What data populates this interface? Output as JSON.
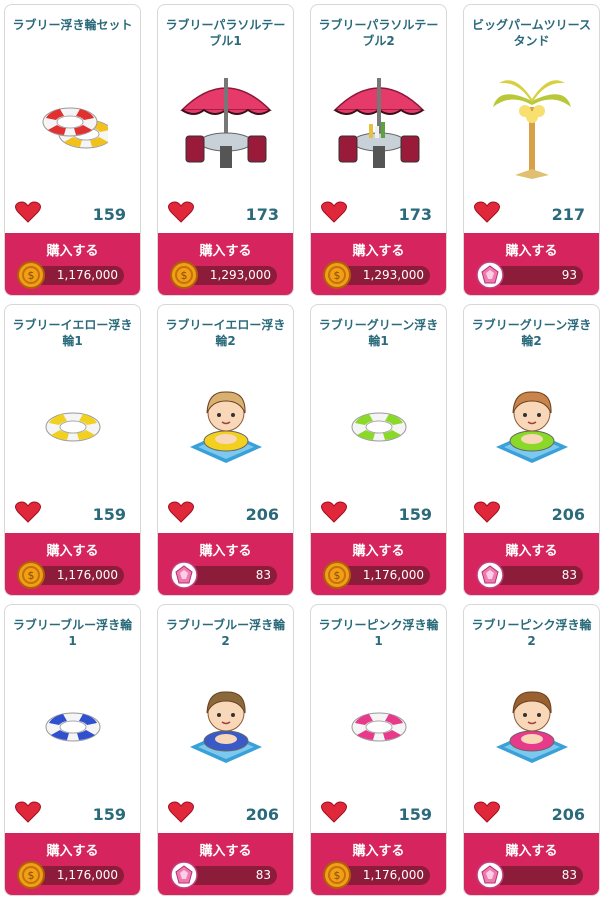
{
  "buy_label": "購入する",
  "items": [
    {
      "name": "ラブリー浮き輪セット",
      "likes": "159",
      "currency": "coin",
      "price": "1,176,000",
      "art": "ringset"
    },
    {
      "name": "ラブリーパラソルテーブル1",
      "likes": "173",
      "currency": "coin",
      "price": "1,293,000",
      "art": "parasol1"
    },
    {
      "name": "ラブリーパラソルテーブル2",
      "likes": "173",
      "currency": "coin",
      "price": "1,293,000",
      "art": "parasol2"
    },
    {
      "name": "ビッグパームツリースタンド",
      "likes": "217",
      "currency": "gem",
      "price": "93",
      "art": "palm"
    },
    {
      "name": "ラブリーイエロー浮き輪1",
      "likes": "159",
      "currency": "coin",
      "price": "1,176,000",
      "art": "ring-yellow"
    },
    {
      "name": "ラブリーイエロー浮き輪2",
      "likes": "206",
      "currency": "gem",
      "price": "83",
      "art": "char-yellow"
    },
    {
      "name": "ラブリーグリーン浮き輪1",
      "likes": "159",
      "currency": "coin",
      "price": "1,176,000",
      "art": "ring-green"
    },
    {
      "name": "ラブリーグリーン浮き輪2",
      "likes": "206",
      "currency": "gem",
      "price": "83",
      "art": "char-green"
    },
    {
      "name": "ラブリーブルー浮き輪1",
      "likes": "159",
      "currency": "coin",
      "price": "1,176,000",
      "art": "ring-blue"
    },
    {
      "name": "ラブリーブルー浮き輪2",
      "likes": "206",
      "currency": "gem",
      "price": "83",
      "art": "char-blue"
    },
    {
      "name": "ラブリーピンク浮き輪1",
      "likes": "159",
      "currency": "coin",
      "price": "1,176,000",
      "art": "ring-pink"
    },
    {
      "name": "ラブリーピンク浮き輪2",
      "likes": "206",
      "currency": "gem",
      "price": "83",
      "art": "char-pink"
    }
  ],
  "colors": {
    "accent": "#d6245f",
    "price_bar": "#8c1c3a",
    "text": "#2a6a7a",
    "heart": "#e0283a",
    "coin": "#e08a10",
    "gem": "#d05a8a"
  }
}
